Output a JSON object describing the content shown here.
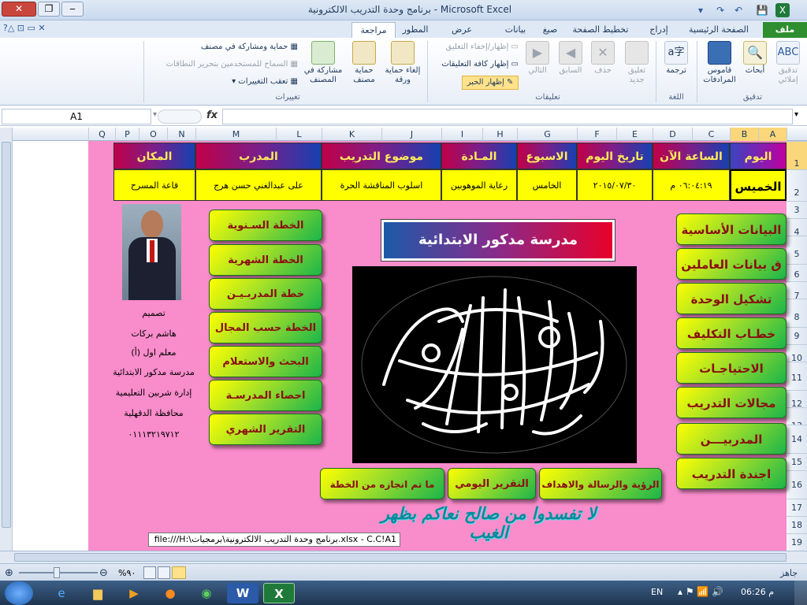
{
  "window": {
    "title": "برنامج وحدة التدريب الالكترونية - Microsoft Excel"
  },
  "tabs": [
    "ملف",
    "الصفحة الرئيسية",
    "إدراج",
    "تخطيط الصفحة",
    "صيغ",
    "بيانات",
    "مراجعة",
    "عرض",
    "المطور"
  ],
  "ribbon": {
    "proofing": {
      "group": "تدقيق",
      "spell": "تدقيق إملائي",
      "research": "أبحاث",
      "thesaurus": "قاموس المرادفات"
    },
    "language": {
      "group": "اللغة",
      "translate": "ترجمة"
    },
    "comments": {
      "group": "تعليقات",
      "new": "تعليق جديد",
      "delete": "حذف",
      "previous": "السابق",
      "next": "التالي",
      "show_hide": "إظهار/إخفاء التعليق",
      "show_all": "إظهار كافة التعليقات",
      "show_ink": "إظهار الحبر"
    },
    "changes": {
      "group": "تغييرات",
      "unprotect_sheet": "إلغاء حماية ورقة",
      "protect_workbook": "حماية مصنف",
      "share_workbook": "مشاركة في المصنف",
      "protect_share": "حماية ومشاركة في مصنف",
      "allow_edit": "السماح للمستخدمين بتحرير النطاقات",
      "track": "تعقب التغييرات"
    }
  },
  "formula_bar": {
    "name_box": "A1",
    "fx": "fx",
    "value": ""
  },
  "columns": [
    "Q",
    "P",
    "O",
    "N",
    "M",
    "L",
    "K",
    "J",
    "I",
    "H",
    "G",
    "F",
    "E",
    "D",
    "C",
    "B",
    "A"
  ],
  "rows": [
    "1",
    "2",
    "3",
    "4",
    "5",
    "6",
    "7",
    "8",
    "9",
    "10",
    "11",
    "12",
    "13",
    "14",
    "15",
    "16",
    "17",
    "18",
    "19"
  ],
  "header_row": {
    "day": "اليوم",
    "time_now": "الساعة الآن",
    "date_today": "تاريخ اليوم",
    "week": "الاسبوع",
    "subject": "المـادة",
    "topic": "موضوع التدريب",
    "trainer": "المدرب",
    "place": "المكان"
  },
  "value_row": {
    "day": "الخميس",
    "time_now": "٠٦:٠٤:١٩ م",
    "date_today": "٢٠١٥/٠٧/٣٠",
    "week": "الخامس",
    "subject": "رعاية الموهوبين",
    "topic": "اسلوب المناقشة الحرة",
    "trainer": "على عبدالغني حسن هرج",
    "place": "قاعة المسرح"
  },
  "school_banner": "مدرسة مدكور الابتدائية",
  "right_buttons": [
    "البيانات الأساسية",
    "ق بيانات العاملين",
    "تشكيل الوحدة",
    "خطـاب التكليف",
    "الاحتياجـات",
    "مجالات التدريب",
    "المدربيـــن",
    "اجندة التدريب"
  ],
  "middle_buttons": [
    "الخطة السـنوية",
    "الخطة الشهرية",
    "خطة المدربـيـن",
    "الخطة حسب المجال",
    "البحث والاستعلام",
    "احصاء المدرسـة",
    "التقرير الشهري"
  ],
  "bottom_buttons": [
    "الرؤية والرسالة والاهداف",
    "التقرير اليومي",
    "ما تم انجازه من الخطة"
  ],
  "designer_info": [
    "تصميم",
    "هاشم بركات",
    "معلم اول (أ)",
    "مدرسة مدكور الابتدائية",
    "إدارة شربين التعليمية",
    "محافظة الدقهلية",
    "٠١١١٣٢١٩٧١٢"
  ],
  "motto": "لا تفسدوا من صالح نعاكم بظهر الغيب",
  "tooltip": "file:///H:\\برنامج وحدة التدريب الالكترونية\\برمجيات.xlsx - C.C!A1",
  "status": {
    "ready": "جاهز",
    "zoom": "%٩٠"
  },
  "taskbar": {
    "lang": "EN",
    "time": "06:26 م"
  },
  "colors": {
    "file_tab": "#2f8f2f",
    "sheet_bg": "#f98ccb",
    "button_text": "#8a1010"
  }
}
